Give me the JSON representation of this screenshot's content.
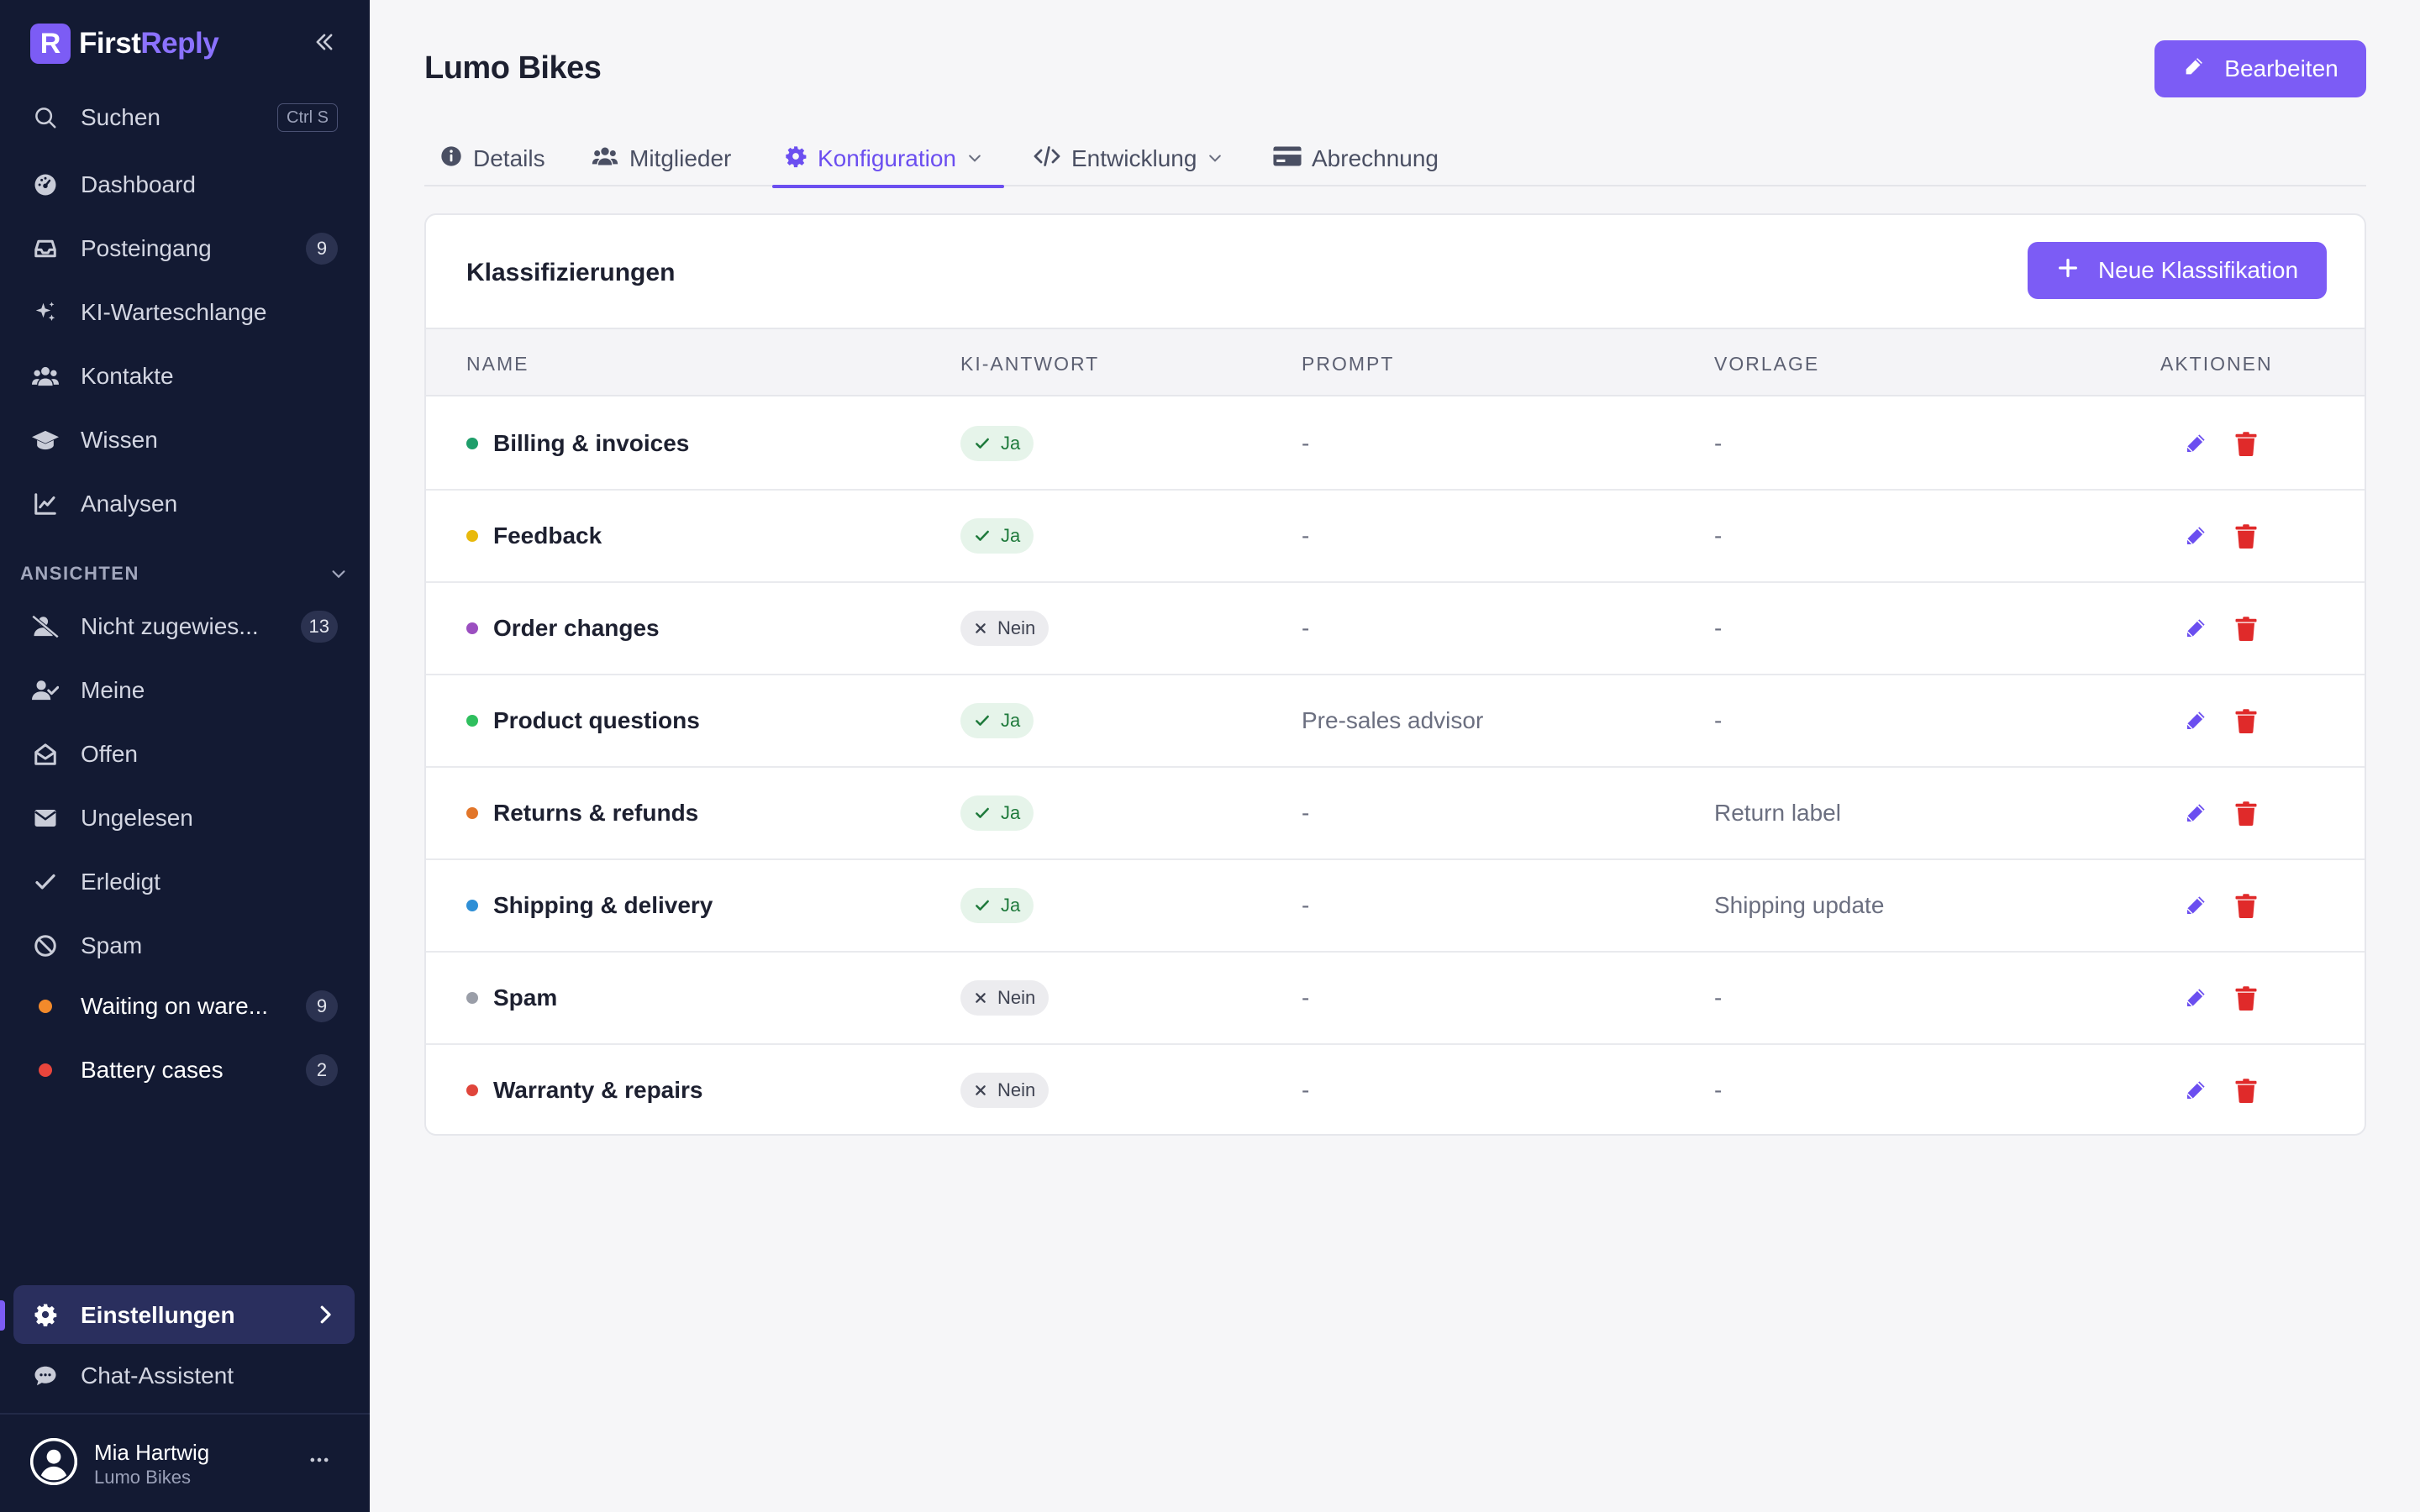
{
  "brand": {
    "name_part1": "First",
    "name_part2": "Reply",
    "mark": "R"
  },
  "sidebar": {
    "search": {
      "label": "Suchen",
      "shortcut": "Ctrl S"
    },
    "items": [
      {
        "label": "Dashboard",
        "icon": "gauge-icon"
      },
      {
        "label": "Posteingang",
        "icon": "inbox-icon",
        "badge": "9"
      },
      {
        "label": "KI-Warteschlange",
        "icon": "sparkles-icon"
      },
      {
        "label": "Kontakte",
        "icon": "users-icon"
      },
      {
        "label": "Wissen",
        "icon": "graduation-cap-icon"
      },
      {
        "label": "Analysen",
        "icon": "chart-line-icon"
      }
    ],
    "views_label": "ANSICHTEN",
    "views": [
      {
        "label": "Nicht zugewies...",
        "icon": "user-slash-icon",
        "badge": "13"
      },
      {
        "label": "Meine",
        "icon": "user-check-icon"
      },
      {
        "label": "Offen",
        "icon": "envelope-open-icon"
      },
      {
        "label": "Ungelesen",
        "icon": "envelope-icon"
      },
      {
        "label": "Erledigt",
        "icon": "check-icon"
      },
      {
        "label": "Spam",
        "icon": "ban-icon"
      },
      {
        "label": "Waiting on ware...",
        "dot_color": "#f28a2b",
        "badge": "9"
      },
      {
        "label": "Battery cases",
        "dot_color": "#e8453c",
        "badge": "2"
      }
    ],
    "settings_label": "Einstellungen",
    "chat_label": "Chat-Assistent",
    "user": {
      "name": "Mia Hartwig",
      "org": "Lumo Bikes"
    }
  },
  "header": {
    "title": "Lumo Bikes",
    "edit_label": "Bearbeiten"
  },
  "tabs": [
    {
      "label": "Details",
      "icon": "info-icon"
    },
    {
      "label": "Mitglieder",
      "icon": "users-icon"
    },
    {
      "label": "Konfiguration",
      "icon": "gear-icon",
      "active": true
    },
    {
      "label": "Entwicklung",
      "icon": "code-icon"
    },
    {
      "label": "Abrechnung",
      "icon": "credit-card-icon"
    }
  ],
  "classifications": {
    "title": "Klassifizierungen",
    "new_label": "Neue Klassifikation",
    "columns": [
      "NAME",
      "KI-ANTWORT",
      "PROMPT",
      "VORLAGE",
      "AKTIONEN"
    ],
    "rows": [
      {
        "name": "Billing & invoices",
        "color": "#1e9e6a",
        "ai": "Ja",
        "ai_on": true,
        "prompt": "-",
        "template": "-"
      },
      {
        "name": "Feedback",
        "color": "#e8b90c",
        "ai": "Ja",
        "ai_on": true,
        "prompt": "-",
        "template": "-"
      },
      {
        "name": "Order changes",
        "color": "#9b4fc0",
        "ai": "Nein",
        "ai_on": false,
        "prompt": "-",
        "template": "-"
      },
      {
        "name": "Product questions",
        "color": "#2fbf5e",
        "ai": "Ja",
        "ai_on": true,
        "prompt": "Pre-sales advisor",
        "template": "-"
      },
      {
        "name": "Returns & refunds",
        "color": "#e2762a",
        "ai": "Ja",
        "ai_on": true,
        "prompt": "-",
        "template": "Return label"
      },
      {
        "name": "Shipping & delivery",
        "color": "#2e8fd6",
        "ai": "Ja",
        "ai_on": true,
        "prompt": "-",
        "template": "Shipping update"
      },
      {
        "name": "Spam",
        "color": "#9a9ea8",
        "ai": "Nein",
        "ai_on": false,
        "prompt": "-",
        "template": "-"
      },
      {
        "name": "Warranty & repairs",
        "color": "#e0453b",
        "ai": "Nein",
        "ai_on": false,
        "prompt": "-",
        "template": "-"
      }
    ]
  },
  "colors": {
    "accent": "#7c5cf5",
    "sidebar_bg": "#131a33",
    "delete": "#e02a2a"
  }
}
